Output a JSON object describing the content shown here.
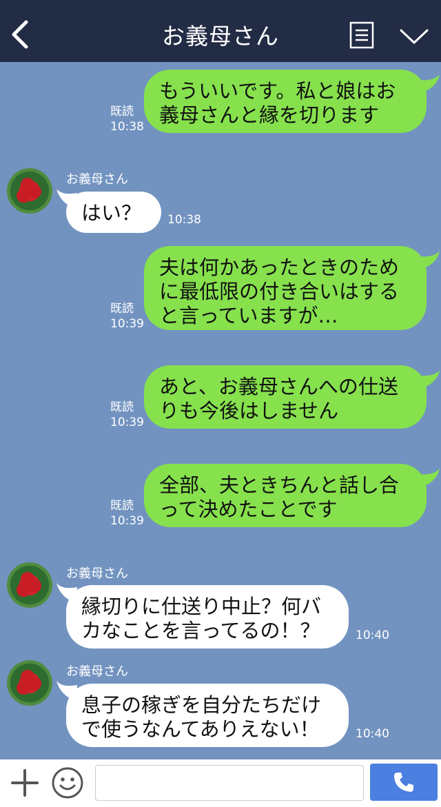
{
  "header": {
    "title": "お義母さん"
  },
  "messages": [
    {
      "from": "me",
      "text": "もういいです。私と娘はお\n義母さんと縁を切ります",
      "read": "既読",
      "time": "10:38"
    },
    {
      "from": "other",
      "name": "お義母さん",
      "text": "はい？",
      "time": "10:38"
    },
    {
      "from": "me",
      "text": "夫は何かあったときのため\nに最低限の付き合いはする\nと言っていますが…",
      "read": "既読",
      "time": "10:39"
    },
    {
      "from": "me",
      "text": "あと、お義母さんへの仕送\nりも今後はしません",
      "read": "既読",
      "time": "10:39"
    },
    {
      "from": "me",
      "text": "全部、夫ときちんと話し合\nって決めたことです",
      "read": "既読",
      "time": "10:39"
    },
    {
      "from": "other",
      "name": "お義母さん",
      "text": "縁切りに仕送り中止？何バ\nカなことを言ってるの！？",
      "time": "10:40"
    },
    {
      "from": "other",
      "name": "お義母さん",
      "text": "息子の稼ぎを自分たちだけ\nで使うなんてありえない！",
      "time": "10:40"
    }
  ],
  "footer": {
    "input_value": ""
  },
  "icons": {
    "back": "chevron-left-icon",
    "menu": "menu-list-icon",
    "expand": "chevron-down-icon",
    "add": "plus-icon",
    "emoji": "emoji-icon",
    "call": "phone-icon"
  },
  "colors": {
    "header_bg": "#232c45",
    "chat_bg": "#7293c0",
    "my_bubble": "#86e14d",
    "other_bubble": "#ffffff",
    "call_button": "#4b7fe0"
  }
}
